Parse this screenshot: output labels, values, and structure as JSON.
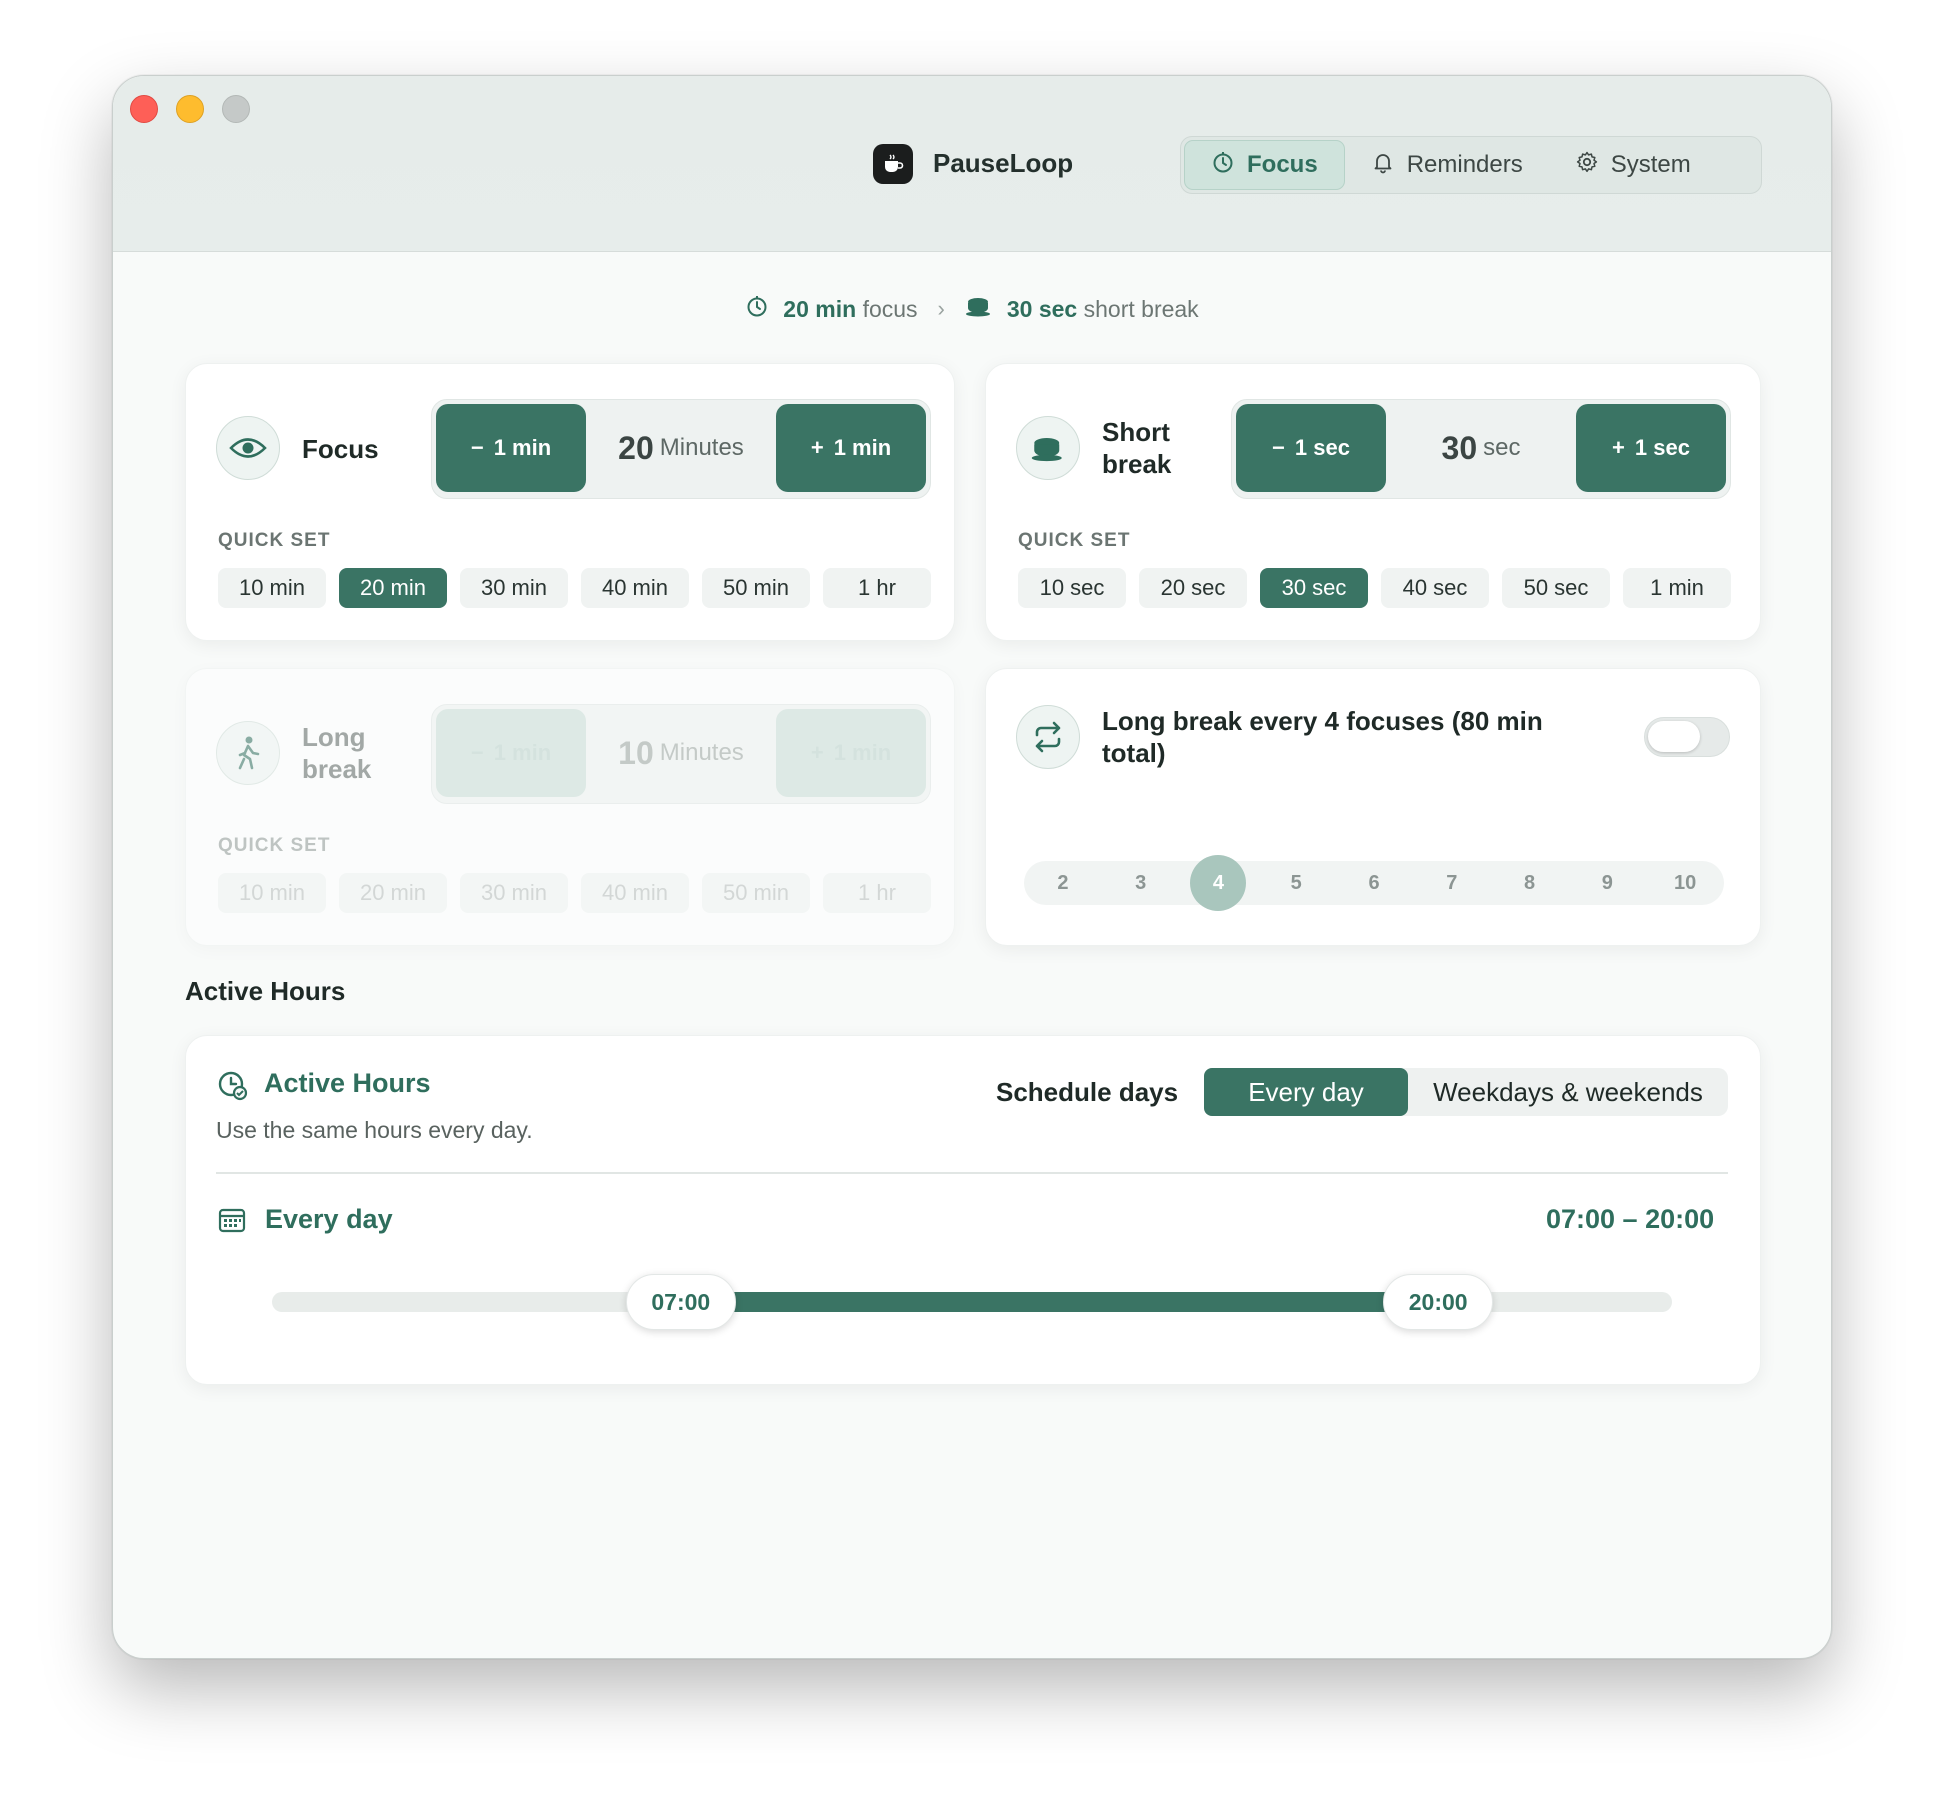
{
  "app": {
    "name": "PauseLoop"
  },
  "nav": {
    "items": [
      {
        "label": "Focus",
        "icon": "timer-icon",
        "active": true
      },
      {
        "label": "Reminders",
        "icon": "bell-icon",
        "active": false
      },
      {
        "label": "System",
        "icon": "gear-icon",
        "active": false
      }
    ]
  },
  "summary": {
    "focus_value": "20 min",
    "focus_text": "focus",
    "break_value": "30 sec",
    "break_text": "short break"
  },
  "focus_card": {
    "title": "Focus",
    "minus_label": "1 min",
    "plus_label": "1 min",
    "value": "20",
    "unit": "Minutes",
    "quick_set_label": "QUICK SET",
    "chips": [
      "10 min",
      "20 min",
      "30 min",
      "40 min",
      "50 min",
      "1 hr"
    ],
    "selected": "20 min"
  },
  "short_break_card": {
    "title_line1": "Short",
    "title_line2": "break",
    "minus_label": "1 sec",
    "plus_label": "1 sec",
    "value": "30",
    "unit": "sec",
    "quick_set_label": "QUICK SET",
    "chips": [
      "10 sec",
      "20 sec",
      "30 sec",
      "40 sec",
      "50 sec",
      "1 min"
    ],
    "selected": "30 sec"
  },
  "long_break_card": {
    "title_line1": "Long",
    "title_line2": "break",
    "minus_label": "1 min",
    "plus_label": "1 min",
    "value": "10",
    "unit": "Minutes",
    "quick_set_label": "QUICK SET",
    "chips": [
      "10 min",
      "20 min",
      "30 min",
      "40 min",
      "50 min",
      "1 hr"
    ],
    "disabled": true
  },
  "long_break_every": {
    "title_line1": "Long break every 4 focuses (80 min",
    "title_line2": "total)",
    "toggle_on": false,
    "counts": [
      "2",
      "3",
      "4",
      "5",
      "6",
      "7",
      "8",
      "9",
      "10"
    ],
    "selected": "4"
  },
  "active_hours": {
    "section_title": "Active Hours",
    "card_title": "Active Hours",
    "subtitle": "Use the same hours every day.",
    "schedule_label": "Schedule days",
    "schedule_options": [
      "Every day",
      "Weekdays & weekends"
    ],
    "schedule_selected": "Every day",
    "row_label": "Every day",
    "range_text": "07:00 – 20:00",
    "start": "07:00",
    "end": "20:00",
    "start_fraction": 0.292,
    "end_fraction": 0.833
  },
  "colors": {
    "accent": "#3a7464",
    "accent_text": "#2f6e5d",
    "window_bg": "#f8faf9"
  }
}
